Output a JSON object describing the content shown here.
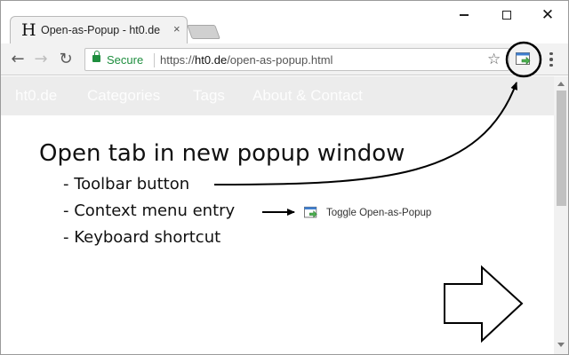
{
  "tab": {
    "favicon_letter": "H",
    "title": "Open-as-Popup - ht0.de",
    "close_glyph": "×"
  },
  "window_controls": {
    "close_glyph": "✕"
  },
  "toolbar": {
    "back_glyph": "←",
    "forward_glyph": "→",
    "reload_glyph": "↻",
    "secure_label": "Secure",
    "url_scheme": "https://",
    "url_host": "ht0.de",
    "url_path": "/open-as-popup.html",
    "bookmark_glyph": "☆",
    "extension_icon": "open-as-popup-icon",
    "menu_icon": "three-dot-menu-icon"
  },
  "site_nav": {
    "items": [
      "ht0.de",
      "Categories",
      "Tags",
      "About & Contact"
    ]
  },
  "content": {
    "headline": "Open tab in new popup window",
    "features": [
      "- Toolbar button",
      "- Context menu entry",
      "- Keyboard shortcut"
    ],
    "context_menu_label": "Toggle Open-as-Popup"
  },
  "colors": {
    "secure_green": "#1e8e3e",
    "icon_green": "#4caf50",
    "icon_blue": "#3f7fd0"
  }
}
